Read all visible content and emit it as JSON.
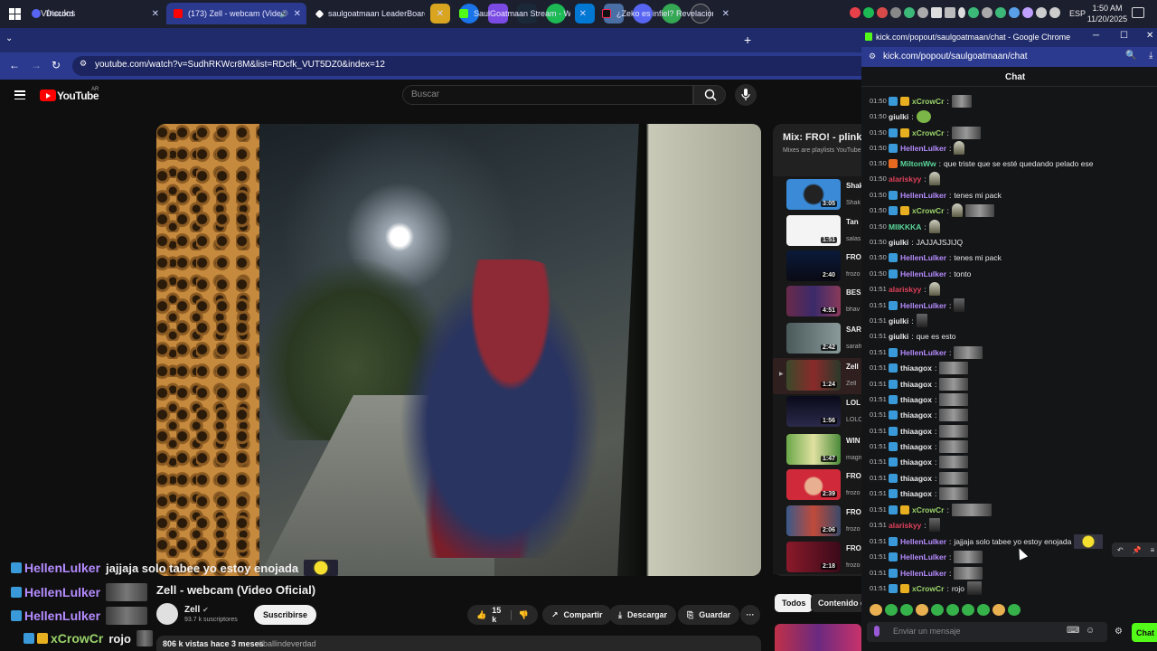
{
  "taskbar": {
    "links_label": "Vínculos",
    "language": "ESP",
    "time": "1:50 AM",
    "date": "11/20/2025"
  },
  "browser": {
    "tabs": [
      {
        "label": "Discord",
        "color": "#5865f2"
      },
      {
        "label": "(173) Zell - webcam (Video",
        "color": "#ff0000"
      },
      {
        "label": "saulgoatmaan LeaderBoard | Th",
        "color": "#ffffff"
      },
      {
        "label": "SaulGoatmaan Stream - Watch",
        "color": "#53fc18"
      },
      {
        "label": "¿Zeko es infiel? Revelaciones e",
        "color": "#111111"
      }
    ],
    "url": "youtube.com/watch?v=SudhRKWcr8M&list=RDcfk_VUT5DZ0&index=12"
  },
  "youtube": {
    "brand": "YouTube",
    "region": "AR",
    "search_placeholder": "Buscar",
    "video_title": "Zell - webcam (Video Oficial)",
    "channel": "Zell",
    "subscribers": "93.7 k suscriptores",
    "subscribe_label": "Suscribirse",
    "likes": "15 k",
    "share_label": "Compartir",
    "download_label": "Descargar",
    "save_label": "Guardar",
    "more_label": "···",
    "desc_stats": "806 k vistas  hace 3 meses",
    "desc_tag": "#ballindeverdad",
    "overlay_chat": [
      {
        "user": "HellenLulker",
        "msg": "jajjaja solo tabee yo estoy enojada"
      },
      {
        "user": "HellenLulker",
        "msg": ""
      },
      {
        "user": "HellenLulker",
        "msg": ""
      },
      {
        "user": "xCrowCr",
        "msg": "rojo"
      }
    ],
    "playlist": {
      "title": "Mix: FRO! - plink",
      "subtitle": "Mixes are playlists YouTube",
      "items": [
        {
          "title": "Shak (Vide",
          "author": "Shak",
          "duration": "3:05"
        },
        {
          "title": "Tan",
          "author": "salas",
          "duration": "1:51"
        },
        {
          "title": "FRO",
          "author": "frozo",
          "duration": "2:40"
        },
        {
          "title": "BESA SEV",
          "author": "bhav",
          "duration": "4:51"
        },
        {
          "title": "SAR talk",
          "author": "sarah",
          "duration": "2:42"
        },
        {
          "title": "Zell",
          "author": "Zell",
          "duration": "1:24"
        },
        {
          "title": "LOL OFIC",
          "author": "LOLO",
          "duration": "1:56"
        },
        {
          "title": "WIN",
          "author": "magn",
          "duration": "1:47"
        },
        {
          "title": "FRO",
          "author": "frozo",
          "duration": "2:39"
        },
        {
          "title": "FRO Ofic",
          "author": "frozo",
          "duration": "2:06"
        },
        {
          "title": "FRO",
          "author": "frozo",
          "duration": "2:18"
        }
      ]
    },
    "chips": {
      "all": "Todos",
      "related": "Contenido de"
    }
  },
  "kick": {
    "window_title": "kick.com/popout/saulgoatmaan/chat - Google Chrome",
    "url": "kick.com/popout/saulgoatmaan/chat",
    "chat_title": "Chat",
    "input_placeholder": "Enviar un mensaje",
    "send_label": "Chat",
    "messages": [
      {
        "time": "01:50",
        "user": "xCrowCr",
        "color": "#9ad36a",
        "text": ""
      },
      {
        "time": "01:50",
        "user": "giulki",
        "color": "#e8e8e8",
        "text": ""
      },
      {
        "time": "01:50",
        "user": "xCrowCr",
        "color": "#9ad36a",
        "text": ""
      },
      {
        "time": "01:50",
        "user": "HellenLulker",
        "color": "#b58cff",
        "text": ""
      },
      {
        "time": "01:50",
        "user": "MiltonWw",
        "color": "#5ad89a",
        "text": "que triste que se esté quedando pelado ese"
      },
      {
        "time": "01:50",
        "user": "alariskyy",
        "color": "#e0405a",
        "text": ""
      },
      {
        "time": "01:50",
        "user": "HellenLulker",
        "color": "#b58cff",
        "text": "tenes mi pack"
      },
      {
        "time": "01:50",
        "user": "xCrowCr",
        "color": "#9ad36a",
        "text": ""
      },
      {
        "time": "01:50",
        "user": "MIIKKKA",
        "color": "#5ad89a",
        "text": ""
      },
      {
        "time": "01:50",
        "user": "giulki",
        "color": "#e8e8e8",
        "text": "JAJJAJSJIJQ"
      },
      {
        "time": "01:50",
        "user": "HellenLulker",
        "color": "#b58cff",
        "text": "tenes mi pack"
      },
      {
        "time": "01:50",
        "user": "HellenLulker",
        "color": "#b58cff",
        "text": "tonto"
      },
      {
        "time": "01:51",
        "user": "alariskyy",
        "color": "#e0405a",
        "text": ""
      },
      {
        "time": "01:51",
        "user": "HellenLulker",
        "color": "#b58cff",
        "text": ""
      },
      {
        "time": "01:51",
        "user": "giulki",
        "color": "#e8e8e8",
        "text": ""
      },
      {
        "time": "01:51",
        "user": "giulki",
        "color": "#e8e8e8",
        "text": "que es esto"
      },
      {
        "time": "01:51",
        "user": "HellenLulker",
        "color": "#b58cff",
        "text": ""
      },
      {
        "time": "01:51",
        "user": "thiaagox",
        "color": "#e8e8e8",
        "text": ""
      },
      {
        "time": "01:51",
        "user": "thiaagox",
        "color": "#e8e8e8",
        "text": ""
      },
      {
        "time": "01:51",
        "user": "thiaagox",
        "color": "#e8e8e8",
        "text": ""
      },
      {
        "time": "01:51",
        "user": "thiaagox",
        "color": "#e8e8e8",
        "text": ""
      },
      {
        "time": "01:51",
        "user": "thiaagox",
        "color": "#e8e8e8",
        "text": ""
      },
      {
        "time": "01:51",
        "user": "thiaagox",
        "color": "#e8e8e8",
        "text": ""
      },
      {
        "time": "01:51",
        "user": "thiaagox",
        "color": "#e8e8e8",
        "text": ""
      },
      {
        "time": "01:51",
        "user": "thiaagox",
        "color": "#e8e8e8",
        "text": ""
      },
      {
        "time": "01:51",
        "user": "thiaagox",
        "color": "#e8e8e8",
        "text": ""
      },
      {
        "time": "01:51",
        "user": "xCrowCr",
        "color": "#9ad36a",
        "text": ""
      },
      {
        "time": "01:51",
        "user": "alariskyy",
        "color": "#e0405a",
        "text": ""
      },
      {
        "time": "01:51",
        "user": "HellenLulker",
        "color": "#b58cff",
        "text": "jajjaja solo tabee yo estoy enojada"
      },
      {
        "time": "01:51",
        "user": "HellenLulker",
        "color": "#b58cff",
        "text": ""
      },
      {
        "time": "01:51",
        "user": "HellenLulker",
        "color": "#b58cff",
        "text": ""
      },
      {
        "time": "01:51",
        "user": "xCrowCr",
        "color": "#9ad36a",
        "text": "rojo"
      }
    ]
  }
}
